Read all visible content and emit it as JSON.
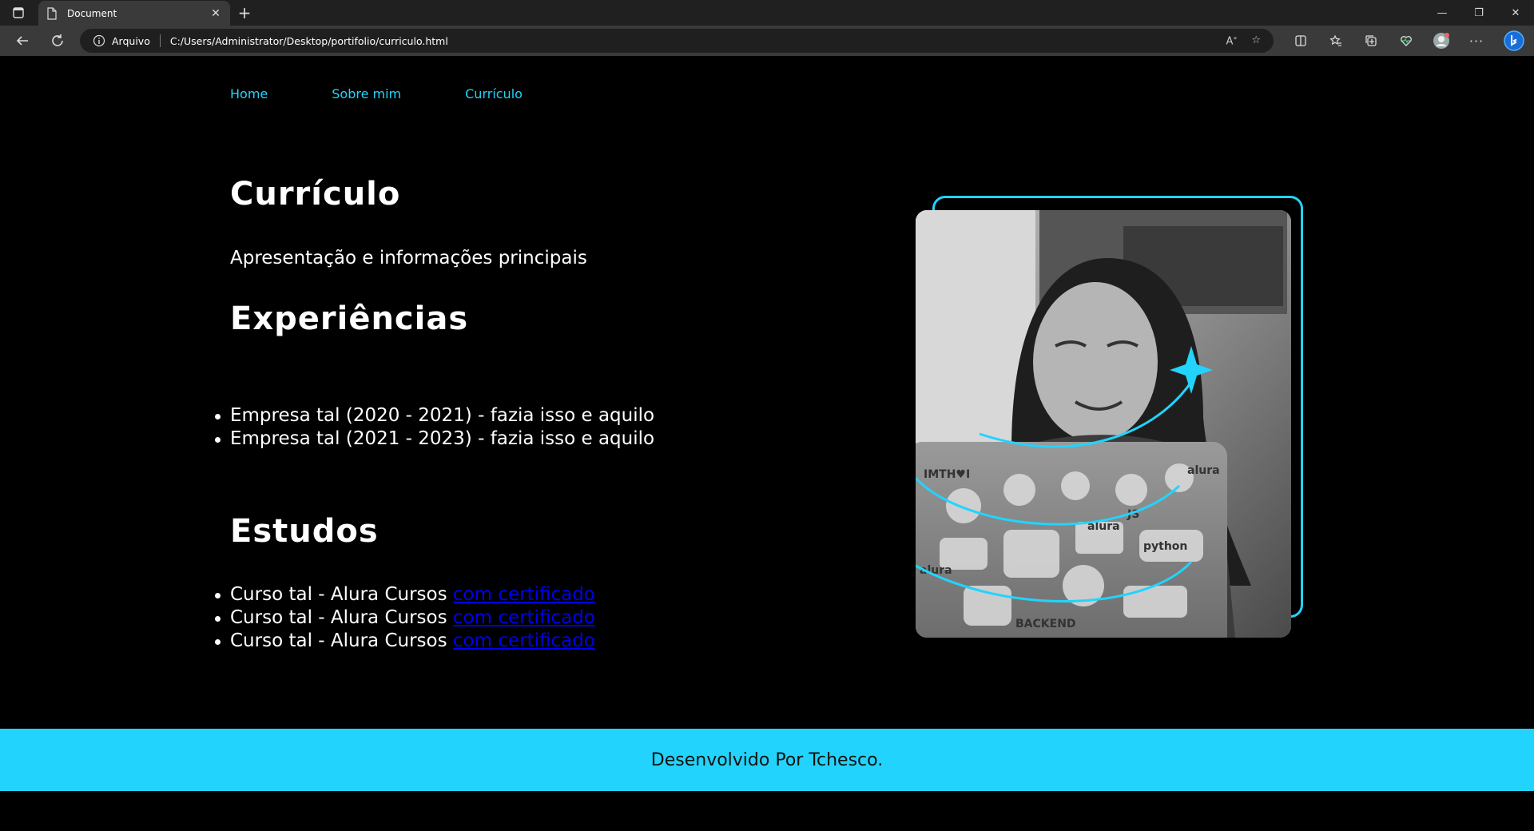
{
  "browser": {
    "tab_title": "Document",
    "protocol_label": "Arquivo",
    "url": "C:/Users/Administrator/Desktop/portifolio/curriculo.html",
    "tab_close": "✕",
    "new_tab": "+",
    "minimize": "—",
    "restore": "❐",
    "close": "✕"
  },
  "nav": {
    "home": "Home",
    "about": "Sobre mim",
    "resume": "Currículo"
  },
  "main": {
    "title": "Currículo",
    "subtitle": "Apresentação e informações principais",
    "experiences_heading": "Experiências",
    "experiences": [
      "Empresa tal (2020 - 2021) - fazia isso e aquilo",
      "Empresa tal (2021 - 2023) - fazia isso e aquilo"
    ],
    "studies_heading": "Estudos",
    "studies": [
      {
        "text": "Curso tal - Alura Cursos ",
        "link": "com certificado"
      },
      {
        "text": "Curso tal - Alura Cursos ",
        "link": "com certificado"
      },
      {
        "text": "Curso tal - Alura Cursos ",
        "link": "com certificado"
      }
    ]
  },
  "footer": {
    "text": "Desenvolvido Por Tchesco."
  },
  "colors": {
    "accent": "#22d4fd",
    "background": "#000000",
    "link": "#0000ee"
  }
}
